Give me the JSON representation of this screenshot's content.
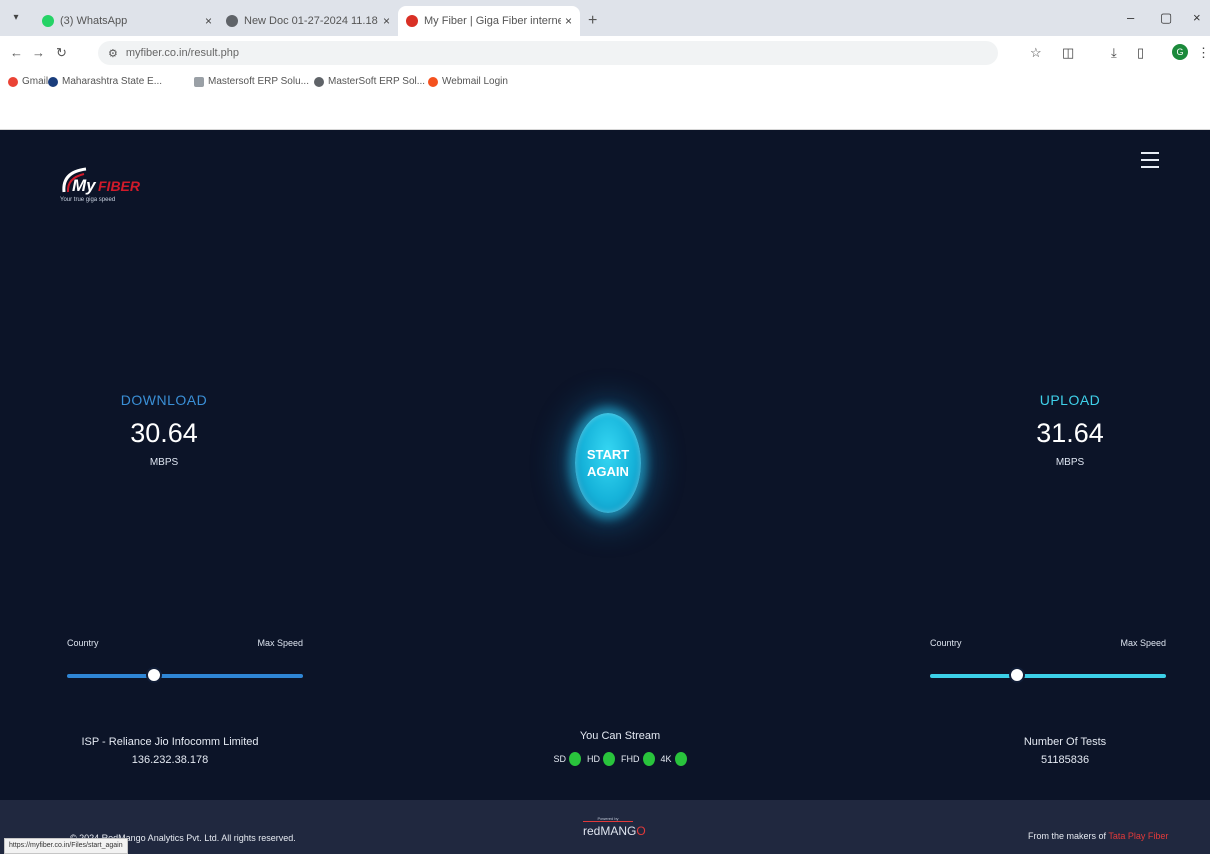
{
  "browser": {
    "tabs": [
      {
        "title": "(3) WhatsApp",
        "active": false,
        "color": "#25d366"
      },
      {
        "title": "New Doc 01-27-2024 11.18",
        "active": false,
        "color": "#5f6368"
      },
      {
        "title": "My Fiber | Giga Fiber internet s",
        "active": true,
        "color": "#d93025"
      }
    ],
    "new_tab": "+",
    "tab_close": "×",
    "window_controls": [
      "–",
      "▢",
      "×"
    ],
    "url": "myfiber.co.in/result.php",
    "profile_initial": "G",
    "bookmarks": [
      {
        "label": "Gmail",
        "color": "#ea4335"
      },
      {
        "label": "Maharashtra State E...",
        "color": "#1a3d7c"
      },
      {
        "label": "Mastersoft ERP Solu...",
        "color": "#9aa0a6"
      },
      {
        "label": "MasterSoft ERP Sol...",
        "color": "#5f6368"
      },
      {
        "label": "Webmail Login",
        "color": "#f4511e"
      }
    ]
  },
  "site": {
    "logo": {
      "text": "MyFiber",
      "tagline": "Your true giga speed"
    },
    "download": {
      "label": "DOWNLOAD",
      "value": "30.64",
      "unit": "MBPS"
    },
    "upload": {
      "label": "UPLOAD",
      "value": "31.64",
      "unit": "MBPS"
    },
    "start_button": {
      "line1": "START",
      "line2": "AGAIN"
    },
    "slider_left": {
      "left_label": "Country",
      "right_label": "Max Speed",
      "position": 0.37
    },
    "slider_right": {
      "left_label": "Country",
      "right_label": "Max Speed",
      "position": 0.37
    },
    "isp": {
      "label": "ISP - Reliance Jio Infocomm Limited",
      "ip": "136.232.38.178"
    },
    "stream": {
      "title": "You Can Stream",
      "formats": [
        "SD",
        "HD",
        "FHD",
        "4K"
      ]
    },
    "tests": {
      "label": "Number Of Tests",
      "count": "51185836"
    },
    "footer": {
      "copyright": "© 2024 RedMango Analytics Pvt. Ltd. All rights reserved.",
      "powered_by": "Powered by",
      "brand_main": "redMANG",
      "brand_tail": "O",
      "makers_prefix": "From the makers of",
      "makers_link": "Tata Play Fiber"
    }
  },
  "status_url": "https://myfiber.co.in/Files/start_again"
}
